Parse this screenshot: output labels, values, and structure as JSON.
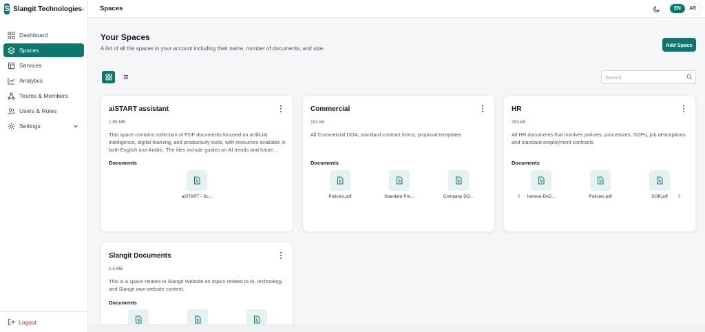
{
  "brand": {
    "logo_letter": "S",
    "name": "Slangit Technologies"
  },
  "sidebar": {
    "items": [
      {
        "label": "Dashboard",
        "icon": "dashboard-icon"
      },
      {
        "label": "Spaces",
        "icon": "layers-icon",
        "active": true
      },
      {
        "label": "Services",
        "icon": "services-icon"
      },
      {
        "label": "Analytics",
        "icon": "analytics-icon"
      },
      {
        "label": "Teams & Members",
        "icon": "teams-icon"
      },
      {
        "label": "Users & Roles",
        "icon": "users-icon"
      },
      {
        "label": "Settings",
        "icon": "gear-icon"
      }
    ],
    "logout_label": "Logout"
  },
  "topbar": {
    "title": "Spaces",
    "lang_en": "EN",
    "lang_ar": "AR"
  },
  "main": {
    "title": "Your Spaces",
    "subtitle": "A list of all the spaces in your account including their name, number of documents, and size.",
    "add_button": "Add Space",
    "search_placeholder": "Search"
  },
  "cards": [
    {
      "title": "aiSTART assistant",
      "size": "1.55 MB",
      "description": "This space contains collection of PDF documents focused on artificial intelligence, digital learning, and productivity tools, with resources available in both English and Arabic. The files include guides on AI trends and future…",
      "docs_label": "Documents",
      "documents": [
        "aiSTART - Sc..."
      ]
    },
    {
      "title": "Commercial",
      "size": "191 kB",
      "description": "All Commercial DOA, standard contract forms, proposal templates",
      "docs_label": "Documents",
      "documents": [
        "Policies.pdf",
        "Standard Pro...",
        "Company DO..."
      ]
    },
    {
      "title": "HR",
      "size": "253 kB",
      "description": "All HR documents that involves policies, procedures, SOPs, job descriptions and standard employment contracts",
      "docs_label": "Documents",
      "documents": [
        "Invoice-DA2...",
        "Policies.pdf",
        "SOP.pdf"
      ]
    },
    {
      "title": "Slangit Documents",
      "size": "1.5 MB",
      "description": "This is a space related to Slangit Website on topics related to AI, technology and Slangit own website content.",
      "docs_label": "Documents",
      "documents": [
        "",
        "",
        ""
      ]
    }
  ],
  "colors": {
    "accent": "#0f766e",
    "danger": "#dc2626",
    "doc_icon_bg": "#e6f2f1"
  }
}
